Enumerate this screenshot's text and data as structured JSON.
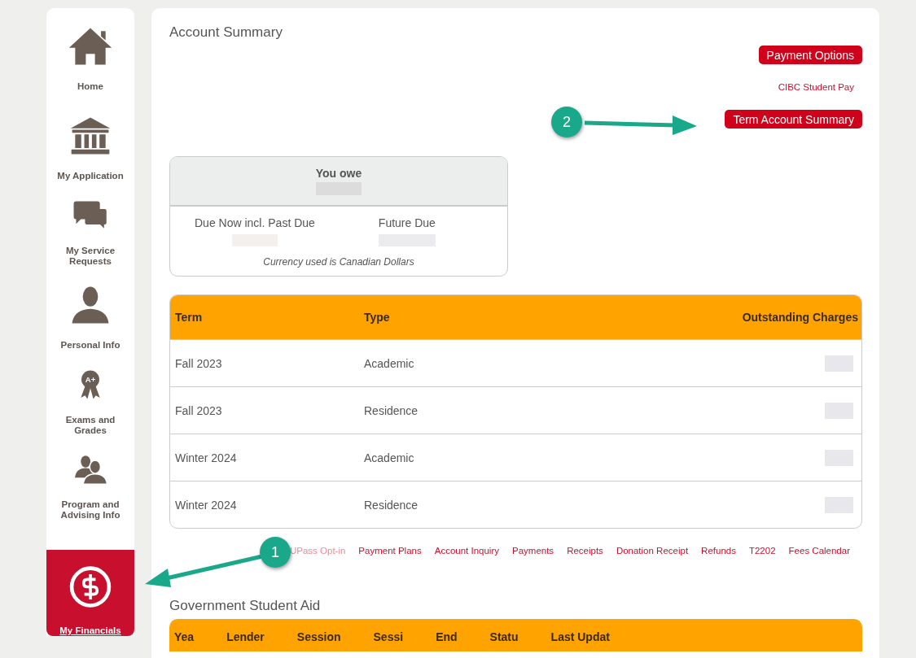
{
  "sidebar": {
    "items": [
      {
        "label": "Home",
        "selected": false
      },
      {
        "label": "My Application",
        "selected": false
      },
      {
        "label": "My Service Requests",
        "selected": false
      },
      {
        "label": "Personal Info",
        "selected": false
      },
      {
        "label": "Exams and Grades",
        "selected": false,
        "badge": "A+"
      },
      {
        "label": "Program and Advising Info",
        "selected": false
      },
      {
        "label": "My Financials",
        "selected": true
      }
    ]
  },
  "title": "Account Summary",
  "actions": {
    "payment_options": "Payment Options",
    "cibc_link": "CIBC Student Pay",
    "term_summary": "Term Account Summary"
  },
  "summary": {
    "heading": "You owe",
    "due_now": "Due Now incl. Past Due",
    "future_due": "Future Due",
    "note": "Currency used is Canadian Dollars"
  },
  "table": {
    "columns": [
      "Term",
      "Type",
      "Outstanding Charges"
    ],
    "rows": [
      {
        "term": "Fall 2023",
        "type": "Academic"
      },
      {
        "term": "Fall 2023",
        "type": "Residence"
      },
      {
        "term": "Winter 2024",
        "type": "Academic"
      },
      {
        "term": "Winter 2024",
        "type": "Residence"
      }
    ]
  },
  "links": [
    {
      "label": "UPass Opt-in",
      "visited": true
    },
    {
      "label": "Payment Plans",
      "visited": false
    },
    {
      "label": "Account Inquiry",
      "visited": false
    },
    {
      "label": "Payments",
      "visited": false
    },
    {
      "label": "Receipts",
      "visited": false
    },
    {
      "label": "Donation Receipt",
      "visited": false
    },
    {
      "label": "Refunds",
      "visited": false
    },
    {
      "label": "T2202",
      "visited": false
    },
    {
      "label": "Fees Calendar",
      "visited": false
    }
  ],
  "aid": {
    "title": "Government Student Aid",
    "columns": [
      "Yea",
      "Lender",
      "Session",
      "Sessi",
      "End",
      "Statu",
      "Last Updat"
    ]
  },
  "callouts": [
    "1",
    "2"
  ]
}
